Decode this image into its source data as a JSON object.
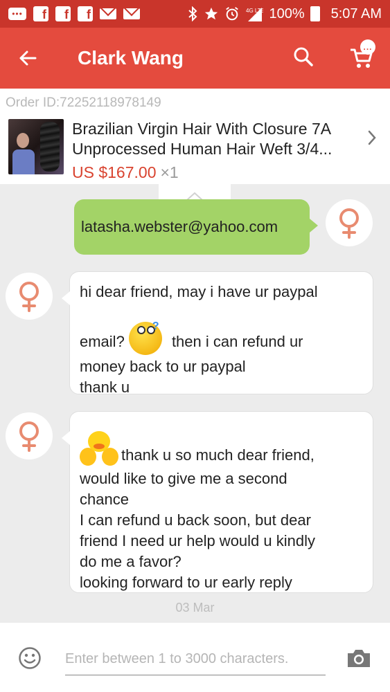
{
  "status_bar": {
    "battery": "100%",
    "time": "5:07 AM",
    "network": "4G LTE",
    "cart_badge": "..."
  },
  "app_bar": {
    "title": "Clark Wang"
  },
  "order": {
    "id_label": "Order ID:72252118978149",
    "title_line1": "Brazilian Virgin Hair With Closure 7A",
    "title_line2": "Unprocessed Human Hair Weft 3/4...",
    "price": "US $167.00",
    "quantity": "×1"
  },
  "messages": {
    "outgoing_1": "latasha.webster@yahoo.com",
    "incoming_1": {
      "line1": "hi dear friend, may i have ur paypal",
      "line2a": "email?",
      "line2b": "then i can refund ur",
      "line3": "money back to ur paypal",
      "line4": "thank u"
    },
    "incoming_2": {
      "line1": "thank u so much dear friend,",
      "line2": "would like to give me a second",
      "line3": "chance",
      "line4": "I can refund u back soon, but dear",
      "line5": "friend I need ur help would u kindly",
      "line6": "do me a favor?",
      "line7": "looking forward to ur early reply"
    }
  },
  "date_separator": "03 Mar",
  "composer": {
    "placeholder": "Enter between 1 to 3000 characters."
  },
  "colors": {
    "status_bar": "#c9352b",
    "app_bar": "#e44b3e",
    "outgoing_bubble": "#a3d367",
    "price": "#d9432f",
    "female_symbol": "#e88b70"
  }
}
